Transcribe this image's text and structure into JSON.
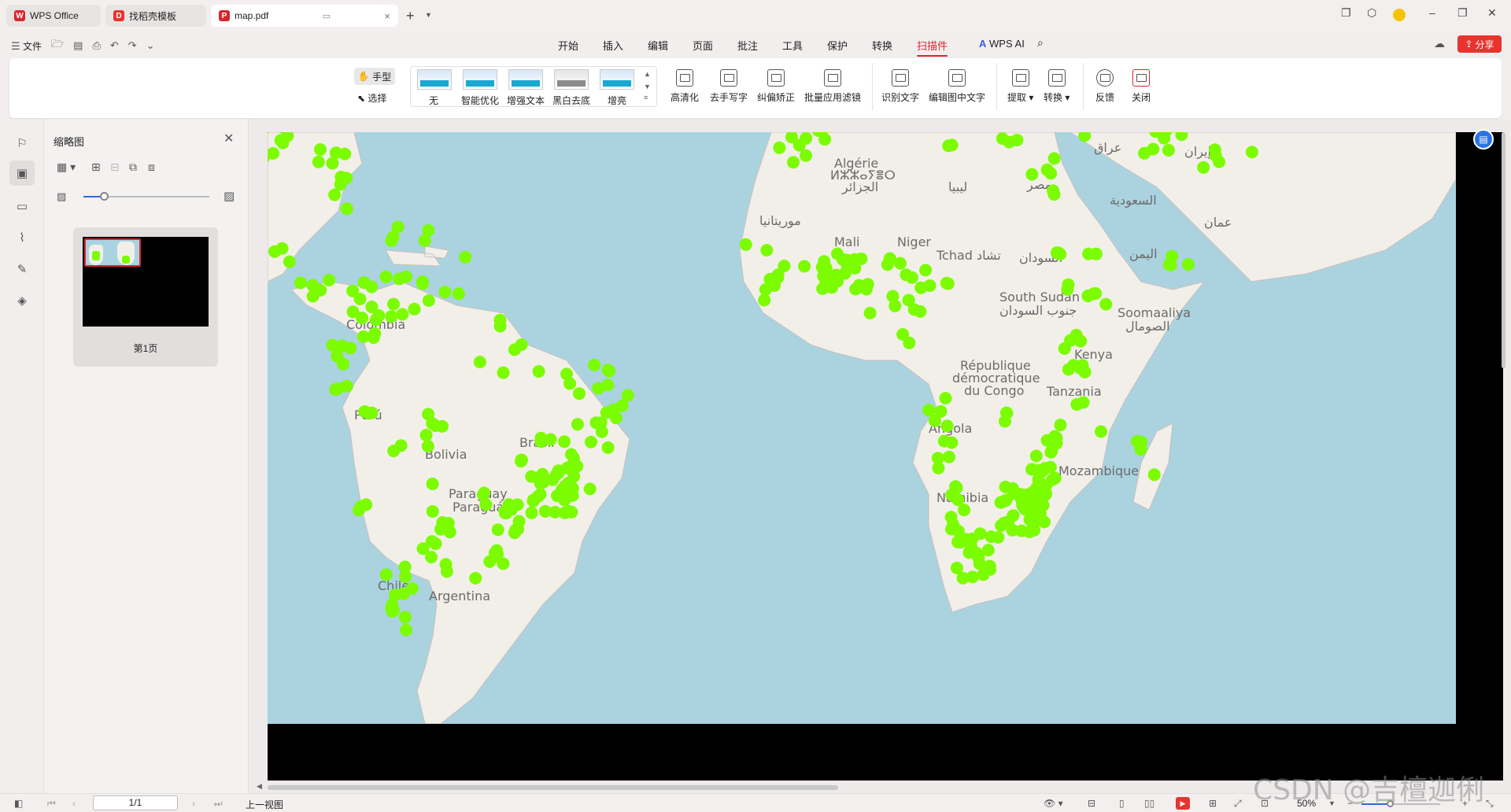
{
  "tabs": [
    {
      "label": "WPS Office",
      "logo": "W",
      "color": "#d8262d"
    },
    {
      "label": "找稻壳模板",
      "logo": "D",
      "color": "#e8332e"
    },
    {
      "label": "map.pdf",
      "logo": "P",
      "color": "#d8262d"
    }
  ],
  "menu": {
    "file": "文件",
    "tabs": [
      "开始",
      "插入",
      "编辑",
      "页面",
      "批注",
      "工具",
      "保护",
      "转换",
      "扫描件"
    ],
    "active_tab": "扫描件",
    "ai": "WPS AI",
    "share": "分享"
  },
  "ribbon": {
    "hand": "手型",
    "select": "选择",
    "filters": [
      "无",
      "智能优化",
      "增强文本",
      "黑白去底",
      "增亮"
    ],
    "filter_thumb_text": "WPS Office",
    "buttons": [
      "高清化",
      "去手写字",
      "纠偏矫正",
      "批量应用滤镜",
      "识别文字",
      "编辑图中文字",
      "提取",
      "转换",
      "反馈",
      "关闭"
    ]
  },
  "panel": {
    "title": "缩略图",
    "page_label": "第1页"
  },
  "map": {
    "labels": [
      {
        "text": "Algérie",
        "cls": "africa"
      },
      {
        "text": "ⵍⵣⵣⴰⵢⴻⵔ",
        "cls": "africa"
      },
      {
        "text": "الجزائر",
        "cls": "africa"
      },
      {
        "text": "ليبيا",
        "cls": "africa"
      },
      {
        "text": "مصر",
        "cls": "africa"
      },
      {
        "text": "موريتانيا",
        "cls": "africa"
      },
      {
        "text": "Mali",
        "cls": "africa"
      },
      {
        "text": "Niger",
        "cls": "africa"
      },
      {
        "text": "Tchad تشاد",
        "cls": "africa"
      },
      {
        "text": "السودان",
        "cls": "africa"
      },
      {
        "text": "South Sudan",
        "cls": "africa"
      },
      {
        "text": "جنوب السودان",
        "cls": "africa"
      },
      {
        "text": "Soomaaliya",
        "cls": "africa"
      },
      {
        "text": "الصومال",
        "cls": "africa"
      },
      {
        "text": "République",
        "cls": "africa"
      },
      {
        "text": "démocratique",
        "cls": "africa"
      },
      {
        "text": "du Congo",
        "cls": "africa"
      },
      {
        "text": "Kenya",
        "cls": "africa"
      },
      {
        "text": "Tanzania",
        "cls": "africa"
      },
      {
        "text": "Angola",
        "cls": "africa"
      },
      {
        "text": "Namibia",
        "cls": "africa"
      },
      {
        "text": "Mozambique",
        "cls": "africa"
      },
      {
        "text": "إيران",
        "cls": "asia"
      },
      {
        "text": "عراق",
        "cls": "asia"
      },
      {
        "text": "السعودية",
        "cls": "asia"
      },
      {
        "text": "عمان",
        "cls": "asia"
      },
      {
        "text": "اليمن",
        "cls": "asia"
      },
      {
        "text": "Colombia",
        "cls": "sa"
      },
      {
        "text": "Perú",
        "cls": "sa"
      },
      {
        "text": "Bolivia",
        "cls": "sa"
      },
      {
        "text": "Brasil",
        "cls": "sa"
      },
      {
        "text": "Paraguay",
        "cls": "sa"
      },
      {
        "text": "Paraguái",
        "cls": "sa"
      },
      {
        "text": "Chile",
        "cls": "sa"
      },
      {
        "text": "Argentina",
        "cls": "sa"
      }
    ],
    "point_color": "#7cfc00",
    "water_color": "#aad3df",
    "land_color": "#f2efe9"
  },
  "status": {
    "page": "1/1",
    "prev_view": "上一视图",
    "zoom": "50%"
  },
  "watermark": "CSDN @吉檀迦俐"
}
